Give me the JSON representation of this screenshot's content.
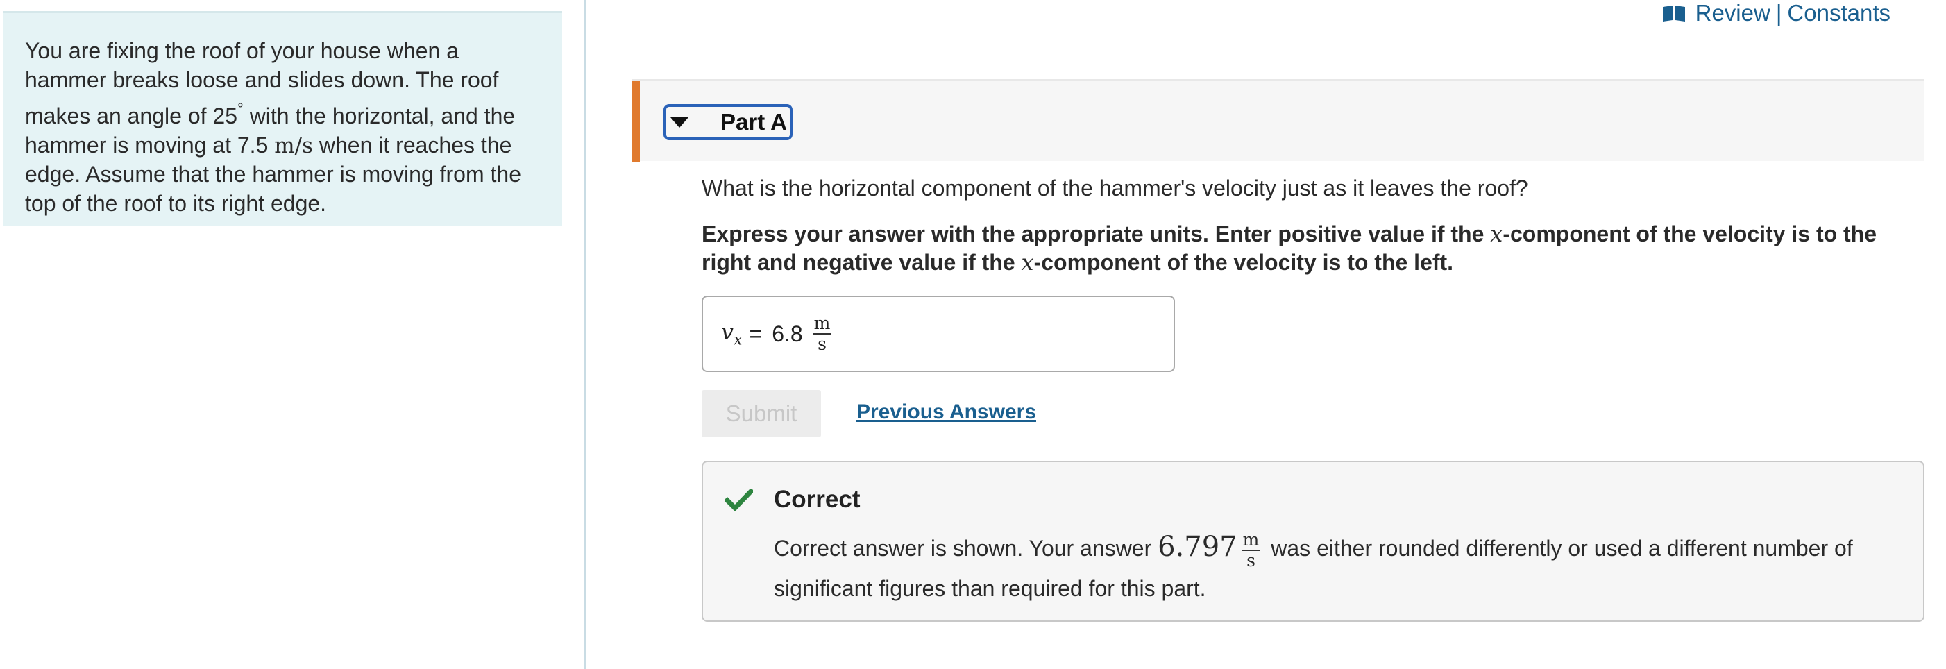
{
  "problem": {
    "text_1": "You are fixing the roof of your house when a hammer breaks loose and slides down. The roof makes an angle of 25",
    "degree": "°",
    "text_2": " with the horizontal, and the hammer is moving at 7.5 ",
    "speed_unit": "m/s",
    "text_3": " when it reaches the edge. Assume that the hammer is moving from the top of the roof to its right edge."
  },
  "toplinks": {
    "icon": "book-icon",
    "review": "Review",
    "separator": "|",
    "constants": "Constants"
  },
  "part": {
    "title": "Part A",
    "accent_color": "#e07a2e",
    "expanded": true
  },
  "question": {
    "text": "What is the horizontal component of the hammer's velocity just as it leaves the roof?",
    "instr_1": "Express your answer with the appropriate units. Enter positive value if the ",
    "instr_var_1": "x",
    "instr_2": "-component of the velocity is to the right and negative value if the ",
    "instr_var_2": "x",
    "instr_3": "-component of the velocity is to the left."
  },
  "answer": {
    "variable": "v",
    "subscript": "x",
    "equals": "=",
    "value": "6.8",
    "unit_num": "m",
    "unit_den": "s"
  },
  "buttons": {
    "submit": "Submit",
    "previous_answers": "Previous Answers"
  },
  "feedback": {
    "status": "Correct",
    "text_1": "Correct answer is shown. Your answer ",
    "value": "6.797",
    "unit_num": "m",
    "unit_den": "s",
    "text_2": " was either rounded differently or used a different number of significant figures than required for this part.",
    "check_color": "#2e8540"
  }
}
